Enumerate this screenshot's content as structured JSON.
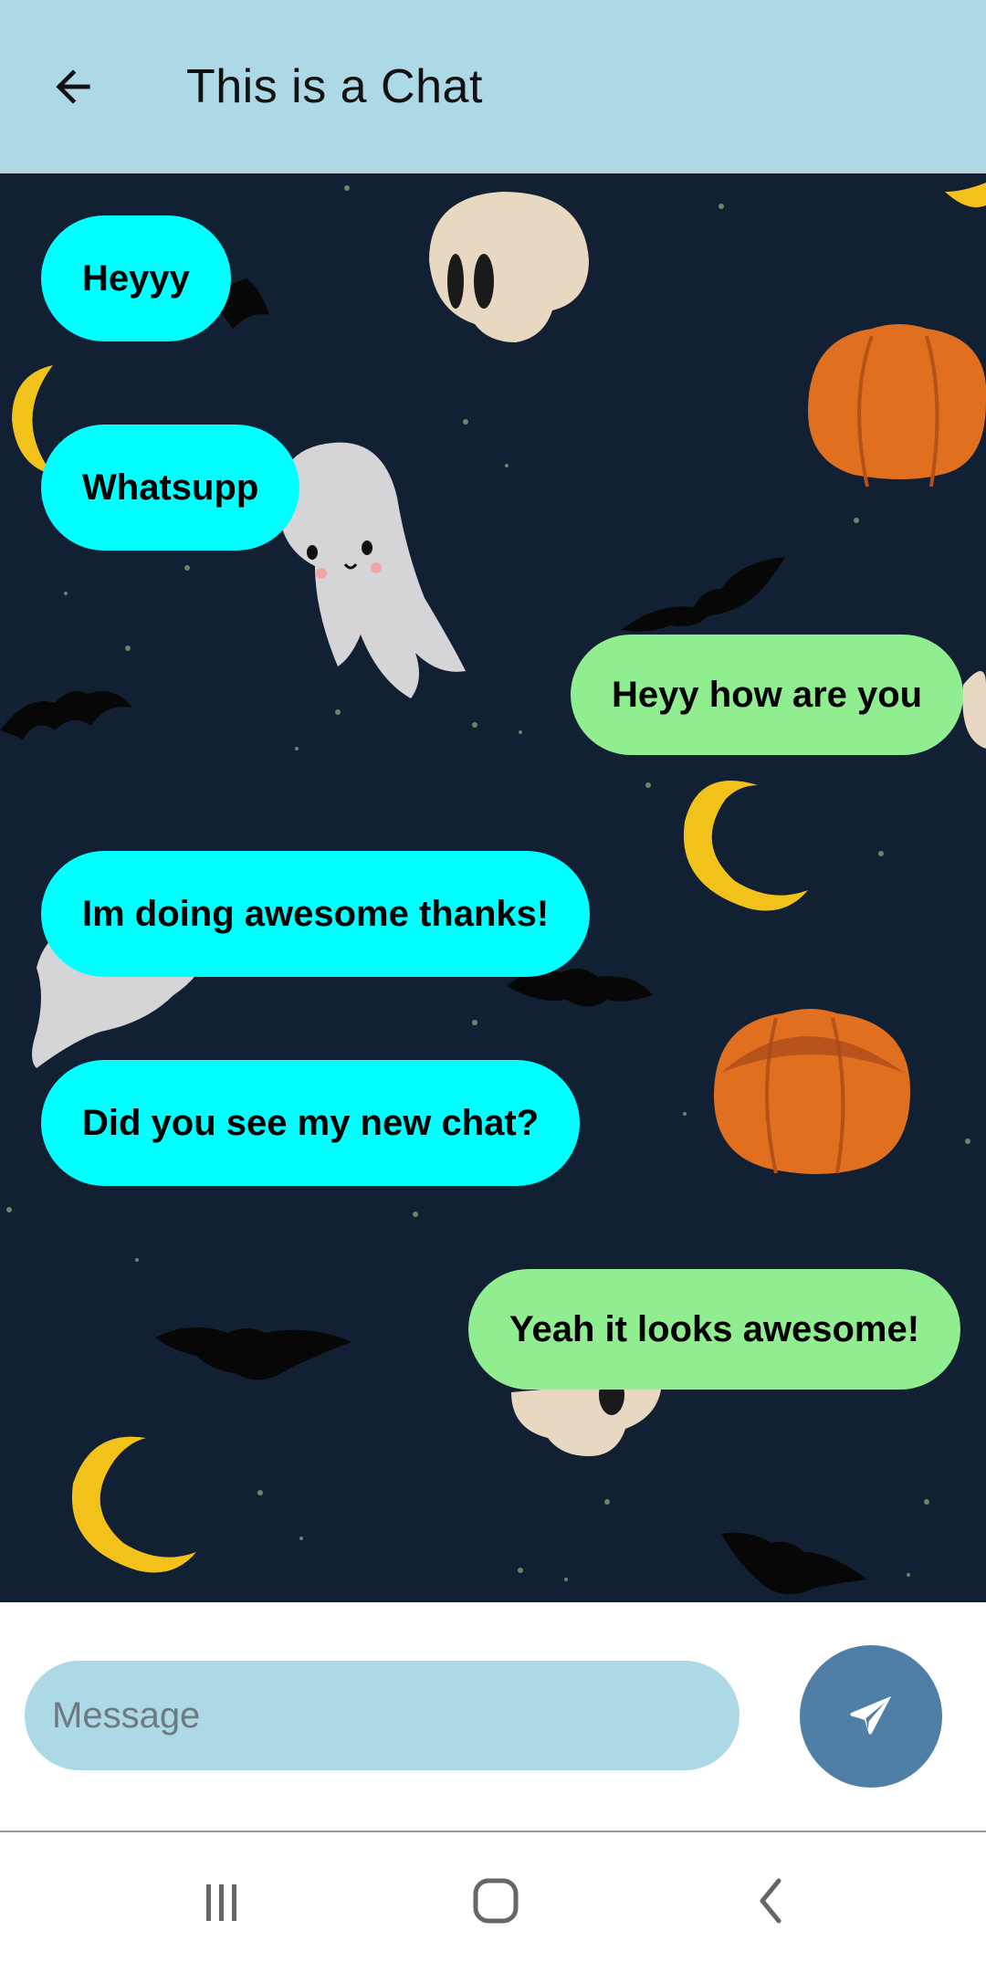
{
  "header": {
    "title": "This is a Chat",
    "back_icon": "arrow-left-icon",
    "background": "#add8e6"
  },
  "chat": {
    "background_theme": "halloween",
    "incoming_color": "#00ffff",
    "outgoing_color": "#90ee90",
    "messages": [
      {
        "text": "Heyyy",
        "direction": "incoming"
      },
      {
        "text": "Whatsupp",
        "direction": "incoming"
      },
      {
        "text": "Heyy how are you",
        "direction": "outgoing"
      },
      {
        "text": "Im doing awesome thanks!",
        "direction": "incoming"
      },
      {
        "text": "Did you see my new chat?",
        "direction": "incoming"
      },
      {
        "text": "Yeah it looks awesome!",
        "direction": "outgoing"
      }
    ]
  },
  "composer": {
    "placeholder": "Message",
    "value": "",
    "send_icon": "paper-plane-icon",
    "send_color": "#4f7ea6"
  },
  "navbar": {
    "recents_icon": "recents-icon",
    "home_icon": "home-icon",
    "back_icon": "nav-back-icon"
  }
}
